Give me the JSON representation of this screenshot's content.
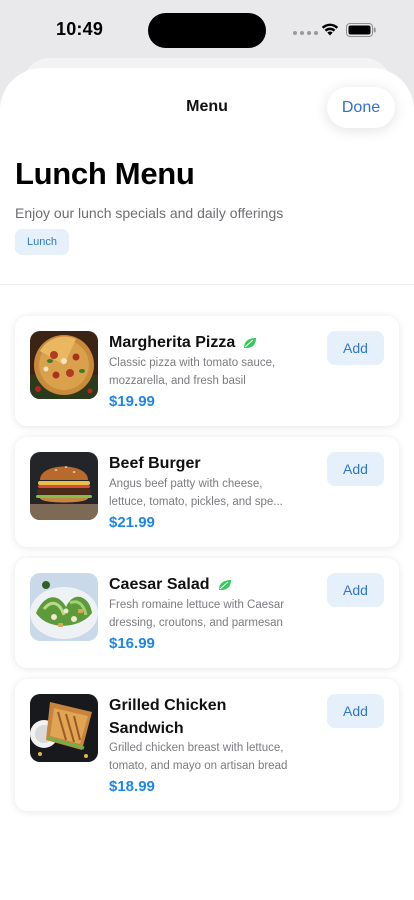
{
  "status_bar": {
    "time": "10:49"
  },
  "nav": {
    "title": "Menu",
    "done_label": "Done"
  },
  "header": {
    "title": "Lunch Menu",
    "subtitle": "Enjoy our lunch specials and daily offerings",
    "tag": "Lunch"
  },
  "items": [
    {
      "name": "Margherita Pizza",
      "vegetarian": true,
      "description": "Classic pizza with tomato sauce, mozzarella, and fresh basil",
      "price": "$19.99",
      "add_label": "Add"
    },
    {
      "name": "Beef Burger",
      "vegetarian": false,
      "description": "Angus beef patty with cheese, lettuce, tomato, pickles, and spe...",
      "price": "$21.99",
      "add_label": "Add"
    },
    {
      "name": "Caesar Salad",
      "vegetarian": true,
      "description": "Fresh romaine lettuce with Caesar dressing, croutons, and parmesan",
      "price": "$16.99",
      "add_label": "Add"
    },
    {
      "name": "Grilled Chicken Sandwich",
      "vegetarian": false,
      "description": "Grilled chicken breast with lettuce, tomato, and mayo on artisan bread",
      "price": "$18.99",
      "add_label": "Add"
    }
  ],
  "colors": {
    "accent": "#1f86e8",
    "done_text": "#2f6fd6",
    "button_bg": "#e6f0fb",
    "leaf": "#34c759"
  },
  "icons": {
    "vegetarian": "leaf-icon",
    "wifi": "wifi-icon",
    "battery": "battery-icon"
  }
}
